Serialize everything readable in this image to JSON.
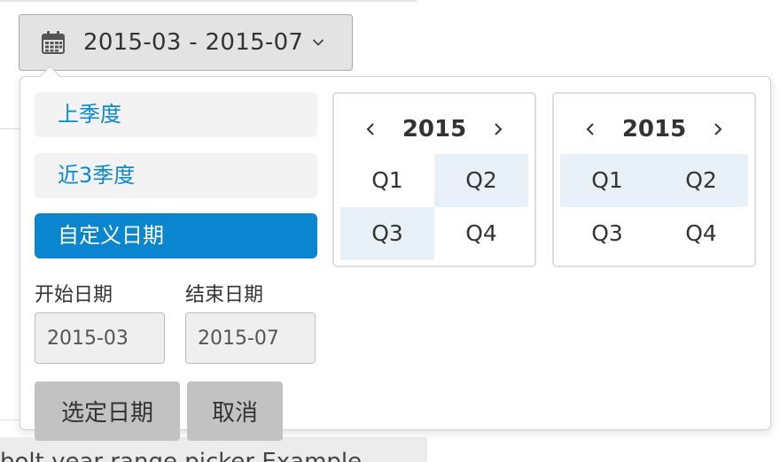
{
  "trigger": {
    "value": "2015-03 - 2015-07"
  },
  "ranges": [
    {
      "label": "上季度",
      "active": false
    },
    {
      "label": "近3季度",
      "active": false
    },
    {
      "label": "自定义日期",
      "active": true
    }
  ],
  "start": {
    "label": "开始日期",
    "value": "2015-03"
  },
  "end": {
    "label": "结束日期",
    "value": "2015-07"
  },
  "buttons": {
    "confirm": "选定日期",
    "cancel": "取消"
  },
  "calendars": [
    {
      "year": "2015",
      "quarters": [
        "Q1",
        "Q2",
        "Q3",
        "Q4"
      ],
      "highlighted": [
        "Q2",
        "Q3"
      ]
    },
    {
      "year": "2015",
      "quarters": [
        "Q1",
        "Q2",
        "Q3",
        "Q4"
      ],
      "highlighted": [
        "Q1",
        "Q2"
      ]
    }
  ],
  "background": {
    "text": "bolt year range picker Example"
  },
  "colors": {
    "accent": "#0a85cf",
    "link": "#0a8ad2",
    "range_bg": "#e8f1f8",
    "button_bg": "#c2c2c2"
  }
}
